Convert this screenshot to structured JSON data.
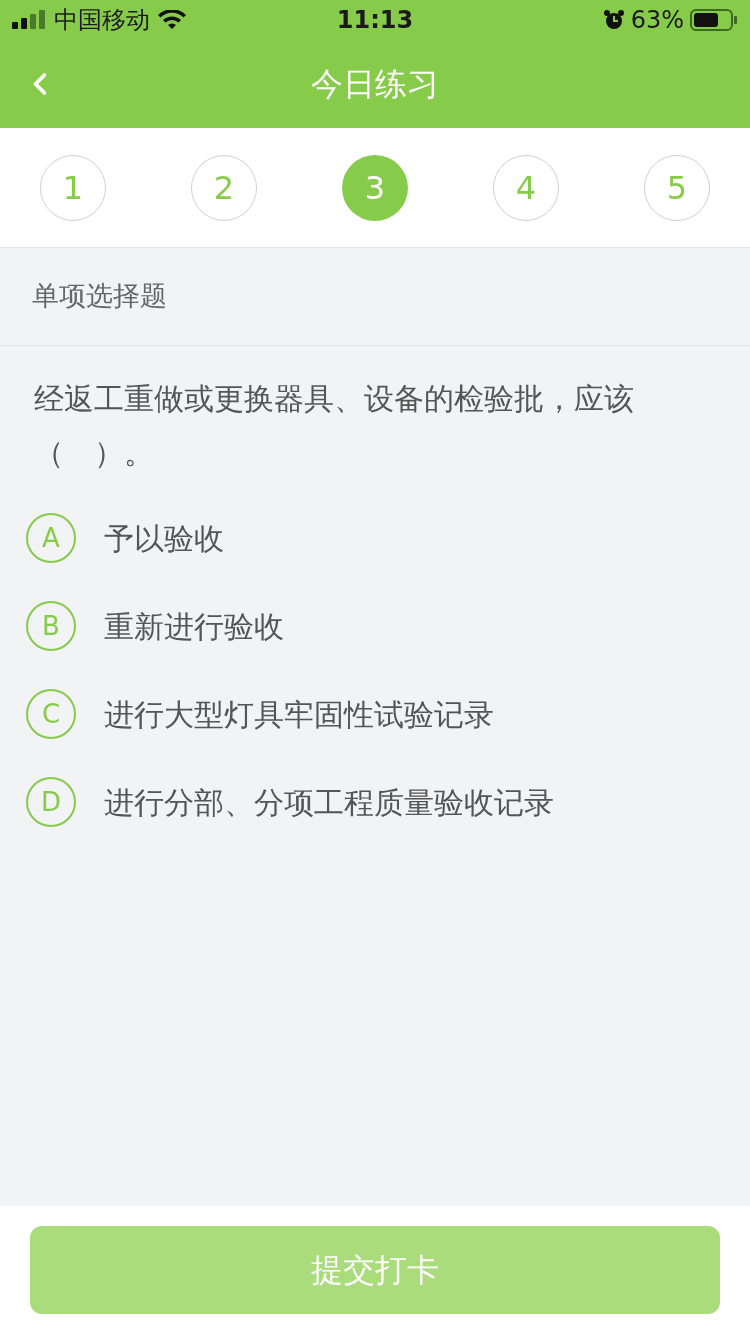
{
  "status_bar": {
    "carrier": "中国移动",
    "time": "11:13",
    "battery": "63%"
  },
  "nav": {
    "title": "今日练习"
  },
  "question_tabs": [
    {
      "label": "1",
      "selected": false
    },
    {
      "label": "2",
      "selected": false
    },
    {
      "label": "3",
      "selected": true
    },
    {
      "label": "4",
      "selected": false
    },
    {
      "label": "5",
      "selected": false
    }
  ],
  "question_type": "单项选择题",
  "question": "经返工重做或更换器具、设备的检验批，应该（　）。",
  "options": [
    {
      "letter": "A",
      "text": "予以验收"
    },
    {
      "letter": "B",
      "text": "重新进行验收"
    },
    {
      "letter": "C",
      "text": "进行大型灯具牢固性试验记录"
    },
    {
      "letter": "D",
      "text": "进行分部、分项工程质量验收记录"
    }
  ],
  "submit": {
    "label": "提交打卡",
    "disabled": true
  }
}
